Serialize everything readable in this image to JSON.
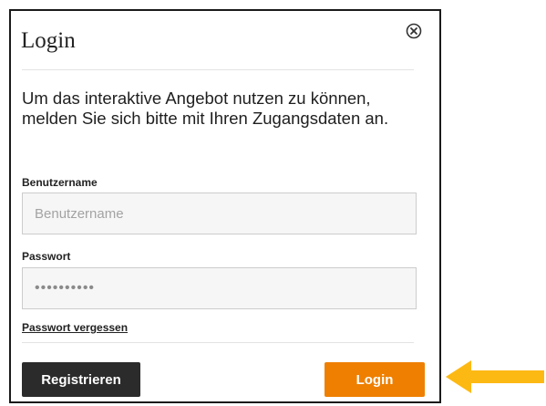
{
  "dialog": {
    "title": "Login",
    "intro_text": "Um das interaktive Angebot nutzen zu können, melden Sie sich bitte mit Ihren Zugangsdaten an.",
    "close_icon": "close-circle-icon"
  },
  "form": {
    "username_label": "Benutzername",
    "username_placeholder": "Benutzername",
    "username_value": "",
    "password_label": "Passwort",
    "password_value": "••••••••••",
    "forgot_link": "Passwort vergessen"
  },
  "buttons": {
    "register_label": "Registrieren",
    "login_label": "Login"
  },
  "colors": {
    "login_button": "#ee7f00",
    "register_button": "#2b2b2b",
    "arrow": "#fdb913"
  },
  "annotation": {
    "icon": "arrow-left-icon"
  }
}
